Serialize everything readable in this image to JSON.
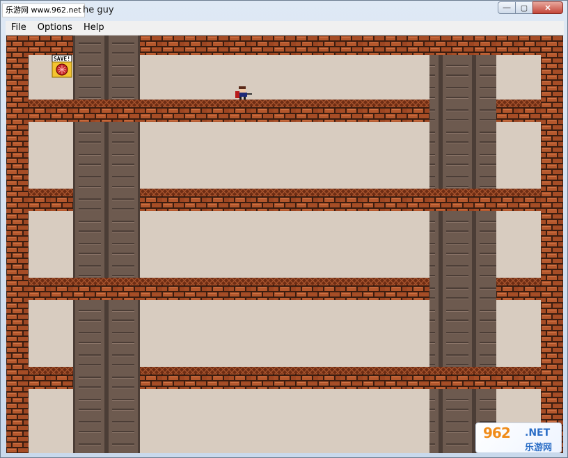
{
  "window": {
    "title": "he guy",
    "watermark_top_left": "乐游网 www.962.net",
    "minimize_glyph": "—",
    "maximize_glyph": "▢",
    "close_glyph": "✕"
  },
  "menubar": {
    "items": [
      {
        "label": "File"
      },
      {
        "label": "Options"
      },
      {
        "label": "Help"
      }
    ]
  },
  "game": {
    "save_sign_label": "SAVE!",
    "colors": {
      "wall_bg": "#d8ccc0",
      "brick": "#b5582d",
      "brick_dark": "#6e2d14",
      "mortar": "#3b1d10",
      "pillar": "#6d5a4f",
      "pillar_dark": "#4b3d36",
      "platform_mesh": "#8c4025"
    }
  },
  "watermark_bottom_right": {
    "number": "962",
    "suffix": ".NET",
    "name": "乐游网"
  }
}
